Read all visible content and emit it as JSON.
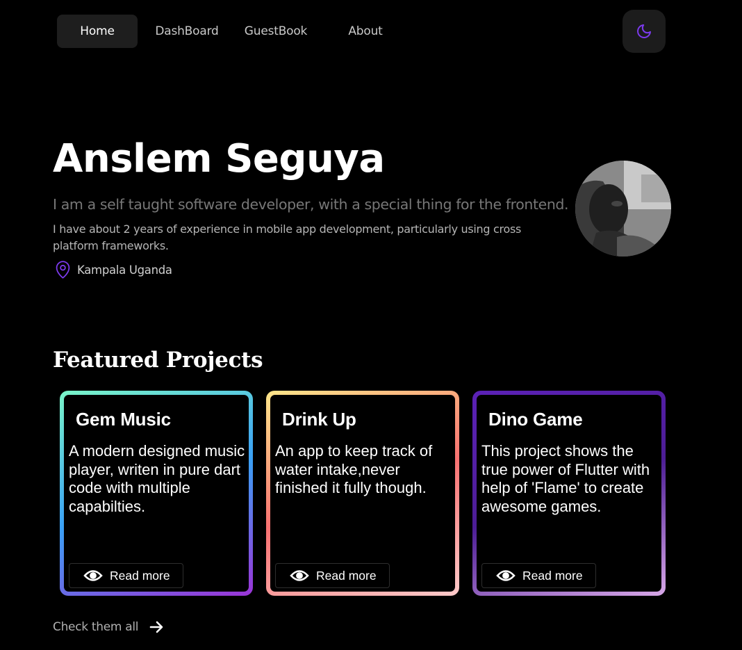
{
  "nav": {
    "items": [
      {
        "label": "Home",
        "active": true
      },
      {
        "label": "DashBoard",
        "active": false
      },
      {
        "label": "GuestBook",
        "active": false
      },
      {
        "label": "About",
        "active": false
      }
    ],
    "theme_icon": "moon-icon"
  },
  "hero": {
    "name": "Anslem Seguya",
    "tagline": "I am a self taught software developer, with a special thing for the frontend.",
    "bio": "I have about 2 years of experience in mobile app development, particularly using cross platform frameworks.",
    "location": "Kampala Uganda"
  },
  "featured": {
    "title": "Featured Projects",
    "projects": [
      {
        "title": "Gem Music",
        "description": "A modern designed music player, writen in pure dart code with multiple capabilties.",
        "button": "Read more",
        "gradient": [
          "#7af5c8",
          "#3aa0f5",
          "#9b34d6"
        ]
      },
      {
        "title": "Drink Up",
        "description": "An app to keep track of water intake,never finished it fully though.",
        "button": "Read more",
        "gradient": [
          "#fde68a",
          "#f87171",
          "#fecaca"
        ]
      },
      {
        "title": "Dino Game",
        "description": "This project shows the true power of Flutter with help of 'Flame' to create awesome games.",
        "button": "Read more",
        "gradient": [
          "#5b21b6",
          "#4c1d95",
          "#d8a8e8"
        ]
      }
    ],
    "check_all": "Check them all"
  },
  "colors": {
    "accent": "#7c3aed",
    "background": "#000000"
  }
}
